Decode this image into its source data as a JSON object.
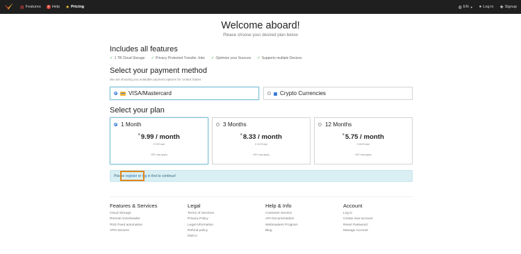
{
  "nav": {
    "features": "Features",
    "help": "Help",
    "pricing": "Pricing",
    "language": "EN",
    "login": "Log in",
    "signup": "Signup"
  },
  "header": {
    "title": "Welcome aboard!",
    "subtitle": "Please choose your desired plan below"
  },
  "features": {
    "heading": "Includes all features",
    "items": [
      "1 TB Cloud Storage",
      "Privacy Protected Transfer Jobs",
      "Optimize your Sources",
      "Supports multiple Devices"
    ]
  },
  "payment": {
    "heading": "Select your payment method",
    "note": "We are showing you available payment options for United States",
    "options": [
      {
        "label": "VISA/Mastercard",
        "selected": true
      },
      {
        "label": "Crypto Currencies",
        "selected": false
      }
    ]
  },
  "plans": {
    "heading": "Select your plan",
    "items": [
      {
        "title": "1 Month",
        "currency": "€",
        "price": "9.99 / month",
        "total": "€ 9.99 total",
        "vat": "VAT may apply",
        "selected": true
      },
      {
        "title": "3 Months",
        "currency": "€",
        "price": "8.33 / month",
        "total": "€ 24.99 total",
        "vat": "VAT may apply",
        "selected": false
      },
      {
        "title": "12 Months",
        "currency": "€",
        "price": "5.75 / month",
        "total": "€ 69.99 total",
        "vat": "VAT may apply",
        "selected": false
      }
    ]
  },
  "alert": {
    "prefix": "Please ",
    "register": "register",
    "middle": " or ",
    "login": "log in",
    "suffix": " first to continue!"
  },
  "footer": {
    "columns": [
      {
        "heading": "Features & Services",
        "links": [
          "Cloud Storage",
          "Remote Downloader",
          "RSS Feed automation",
          "VPN Servers"
        ]
      },
      {
        "heading": "Legal",
        "links": [
          "Terms of Services",
          "Privacy Policy",
          "Legal Information",
          "Refund policy",
          "DMCA"
        ]
      },
      {
        "heading": "Help & Info",
        "links": [
          "Customer Service",
          "API Documentation",
          "Webmasters Program",
          "Blog"
        ]
      },
      {
        "heading": "Account",
        "links": [
          "Log in",
          "Create new account",
          "Reset Password",
          "Manage Account"
        ]
      }
    ]
  },
  "colors": {
    "nav_bg": "#1f1f1f",
    "accent": "#7cc2d6",
    "highlight": "#e0861b",
    "check": "#3aa34a"
  }
}
